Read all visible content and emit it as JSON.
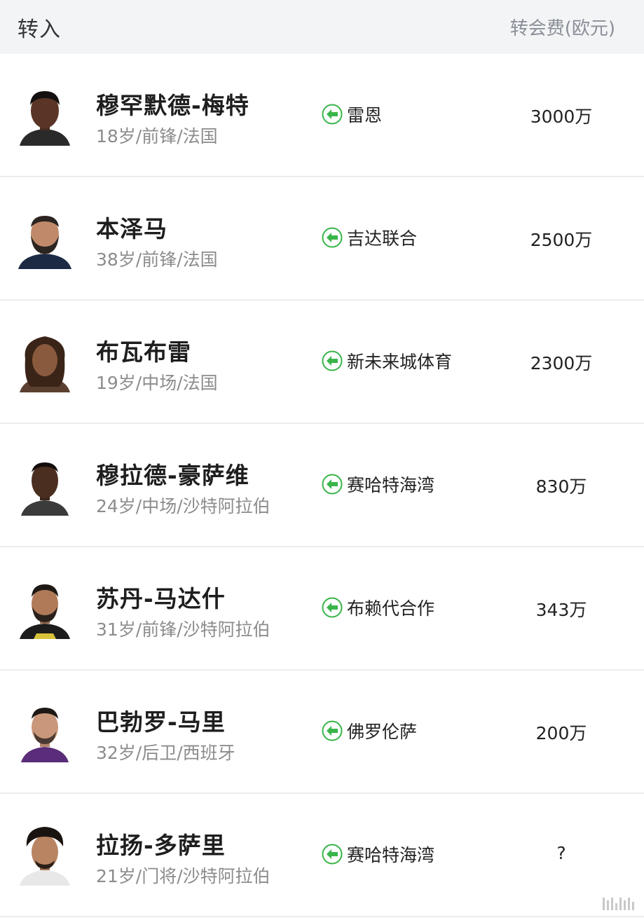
{
  "header": {
    "title": "转入",
    "fee_label": "转会费(欧元)"
  },
  "rows": [
    {
      "name": "穆罕默德-梅特",
      "meta": "18岁/前锋/法国",
      "club": "雷恩",
      "fee": "3000万"
    },
    {
      "name": "本泽马",
      "meta": "38岁/前锋/法国",
      "club": "吉达联合",
      "fee": "2500万"
    },
    {
      "name": "布瓦布雷",
      "meta": "19岁/中场/法国",
      "club": "新未来城体育",
      "fee": "2300万"
    },
    {
      "name": "穆拉德-豪萨维",
      "meta": "24岁/中场/沙特阿拉伯",
      "club": "赛哈特海湾",
      "fee": "830万"
    },
    {
      "name": "苏丹-马达什",
      "meta": "31岁/前锋/沙特阿拉伯",
      "club": "布赖代合作",
      "fee": "343万"
    },
    {
      "name": "巴勃罗-马里",
      "meta": "32岁/后卫/西班牙",
      "club": "佛罗伦萨",
      "fee": "200万"
    },
    {
      "name": "拉扬-多萨里",
      "meta": "21岁/门将/沙特阿拉伯",
      "club": "赛哈特海湾",
      "fee": "?"
    }
  ],
  "colors": {
    "arrow_green": "#39b54a",
    "header_bg": "#f3f4f6"
  },
  "icons": {
    "transfer_in": "arrow-left-circle-icon"
  }
}
